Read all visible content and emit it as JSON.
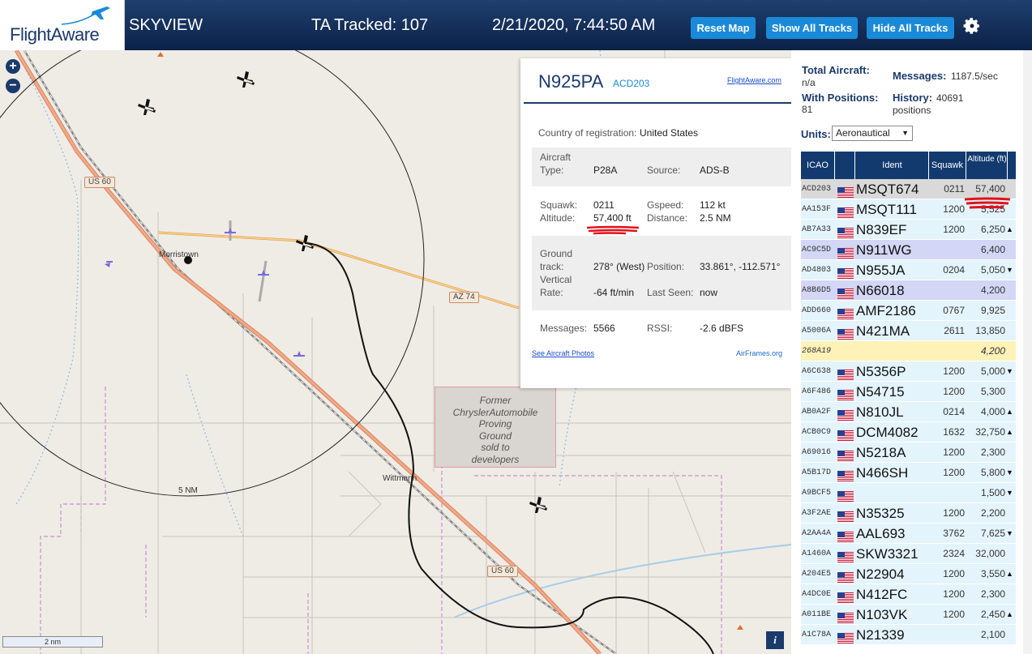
{
  "header": {
    "brand": "FlightAware",
    "app_title": "SKYVIEW",
    "tracked": "TA Tracked: 107",
    "datetime": "2/21/2020, 7:44:50 AM",
    "buttons": {
      "reset": "Reset Map",
      "show_all": "Show All Tracks",
      "hide_all": "Hide All Tracks"
    },
    "settings_icon": "gear-icon"
  },
  "map": {
    "zoom_in": "+",
    "zoom_out": "−",
    "labels": {
      "town1": "Morristown",
      "town2": "Wittmann",
      "range": "5 NM"
    },
    "shields": {
      "us60_a": "US 60",
      "az74": "AZ 74",
      "us60_b": "US 60"
    },
    "chrysler": [
      "Former",
      "ChryslerAutomobile",
      "Proving",
      "Ground",
      "sold to",
      "developers"
    ],
    "scale": "2 nm",
    "info": "i"
  },
  "popup": {
    "registration": "N925PA",
    "icao": "ACD203",
    "fa_link": "FlightAware.com",
    "country_label": "Country of registration:",
    "country": "United States",
    "aircraft_label": "Aircraft",
    "type_label": "Type:",
    "type": "P28A",
    "source_label": "Source:",
    "source": "ADS-B",
    "squawk_label": "Squawk:",
    "squawk": "0211",
    "gspeed_label": "Gspeed:",
    "gspeed": "112 kt",
    "altitude_label": "Altitude:",
    "altitude": "57,400 ft",
    "distance_label": "Distance:",
    "distance": "2.5 NM",
    "ground_label": "Ground",
    "track_label": "track:",
    "track": "278° (West)",
    "position_label": "Position:",
    "position": "33.861°, -112.571°",
    "vertical_label": "Vertical",
    "rate_label": "Rate:",
    "rate": "-64 ft/min",
    "lastseen_label": "Last Seen:",
    "lastseen": "now",
    "messages_label": "Messages:",
    "messages": "5566",
    "rssi_label": "RSSI:",
    "rssi": "-2.6 dBFS",
    "photos_link": "See Aircraft Photos",
    "airframes_link": "AirFrames.org"
  },
  "panel": {
    "total_label": "Total Aircraft:",
    "total": "n/a",
    "messages_label": "Messages:",
    "messages": "1187.5/sec",
    "with_pos_label": "With Positions:",
    "with_pos": "81",
    "history_label": "History:",
    "history": "40691 positions",
    "units_label": "Units:",
    "units_value": "Aeronautical",
    "columns": {
      "icao": "ICAO",
      "ident": "Ident",
      "squawk": "Squawk",
      "altitude": "Altitude (ft)"
    },
    "rows": [
      {
        "icao": "ACD203",
        "ident": "MSQT674",
        "squawk": "0211",
        "alt": "57,400",
        "trend": "",
        "style": "selected"
      },
      {
        "icao": "AA153F",
        "ident": "MSQT111",
        "squawk": "1200",
        "alt": "5,525",
        "trend": "",
        "style": ""
      },
      {
        "icao": "AB7A33",
        "ident": "N839EF",
        "squawk": "1200",
        "alt": "6,250",
        "trend": "▲",
        "style": ""
      },
      {
        "icao": "AC9C5D",
        "ident": "N911WG",
        "squawk": "",
        "alt": "6,400",
        "trend": "",
        "style": "dim"
      },
      {
        "icao": "AD4803",
        "ident": "N955JA",
        "squawk": "0204",
        "alt": "5,050",
        "trend": "▼",
        "style": ""
      },
      {
        "icao": "A8B6D5",
        "ident": "N66018",
        "squawk": "",
        "alt": "4,200",
        "trend": "",
        "style": "dim"
      },
      {
        "icao": "ADD660",
        "ident": "AMF2186",
        "squawk": "0767",
        "alt": "9,925",
        "trend": "",
        "style": ""
      },
      {
        "icao": "A5006A",
        "ident": "N421MA",
        "squawk": "2611",
        "alt": "13,850",
        "trend": "",
        "style": ""
      },
      {
        "icao": "268A19",
        "ident": "",
        "squawk": "",
        "alt": "4,200",
        "trend": "",
        "style": "yellow",
        "noflag": true
      },
      {
        "icao": "A6C638",
        "ident": "N5356P",
        "squawk": "1200",
        "alt": "5,000",
        "trend": "▼",
        "style": ""
      },
      {
        "icao": "A6F486",
        "ident": "N54715",
        "squawk": "1200",
        "alt": "5,300",
        "trend": "",
        "style": ""
      },
      {
        "icao": "AB0A2F",
        "ident": "N810JL",
        "squawk": "0214",
        "alt": "4,000",
        "trend": "▲",
        "style": ""
      },
      {
        "icao": "ACB0C9",
        "ident": "DCM4082",
        "squawk": "1632",
        "alt": "32,750",
        "trend": "▲",
        "style": ""
      },
      {
        "icao": "A69016",
        "ident": "N5218A",
        "squawk": "1200",
        "alt": "2,300",
        "trend": "",
        "style": ""
      },
      {
        "icao": "A5B17D",
        "ident": "N466SH",
        "squawk": "1200",
        "alt": "5,800",
        "trend": "▼",
        "style": ""
      },
      {
        "icao": "A9BCF5",
        "ident": "",
        "squawk": "",
        "alt": "1,500",
        "trend": "▼",
        "style": ""
      },
      {
        "icao": "A3F2AE",
        "ident": "N35325",
        "squawk": "1200",
        "alt": "2,200",
        "trend": "",
        "style": ""
      },
      {
        "icao": "A2AA4A",
        "ident": "AAL693",
        "squawk": "3762",
        "alt": "7,625",
        "trend": "▼",
        "style": ""
      },
      {
        "icao": "A1460A",
        "ident": "SKW3321",
        "squawk": "2324",
        "alt": "32,000",
        "trend": "",
        "style": ""
      },
      {
        "icao": "A204E5",
        "ident": "N22904",
        "squawk": "1200",
        "alt": "3,550",
        "trend": "▲",
        "style": ""
      },
      {
        "icao": "A4DC0E",
        "ident": "N412FC",
        "squawk": "1200",
        "alt": "2,300",
        "trend": "",
        "style": ""
      },
      {
        "icao": "A011BE",
        "ident": "N103VK",
        "squawk": "1200",
        "alt": "2,450",
        "trend": "▲",
        "style": ""
      },
      {
        "icao": "A1C78A",
        "ident": "N21339",
        "squawk": "",
        "alt": "2,100",
        "trend": "",
        "style": ""
      }
    ]
  },
  "colors": {
    "header_bg": "#0b2248",
    "button": "#1a8ad8",
    "brand": "#1a3a6b",
    "row_bg": "#e4f4fc",
    "highlight_red": "#e0121b"
  }
}
